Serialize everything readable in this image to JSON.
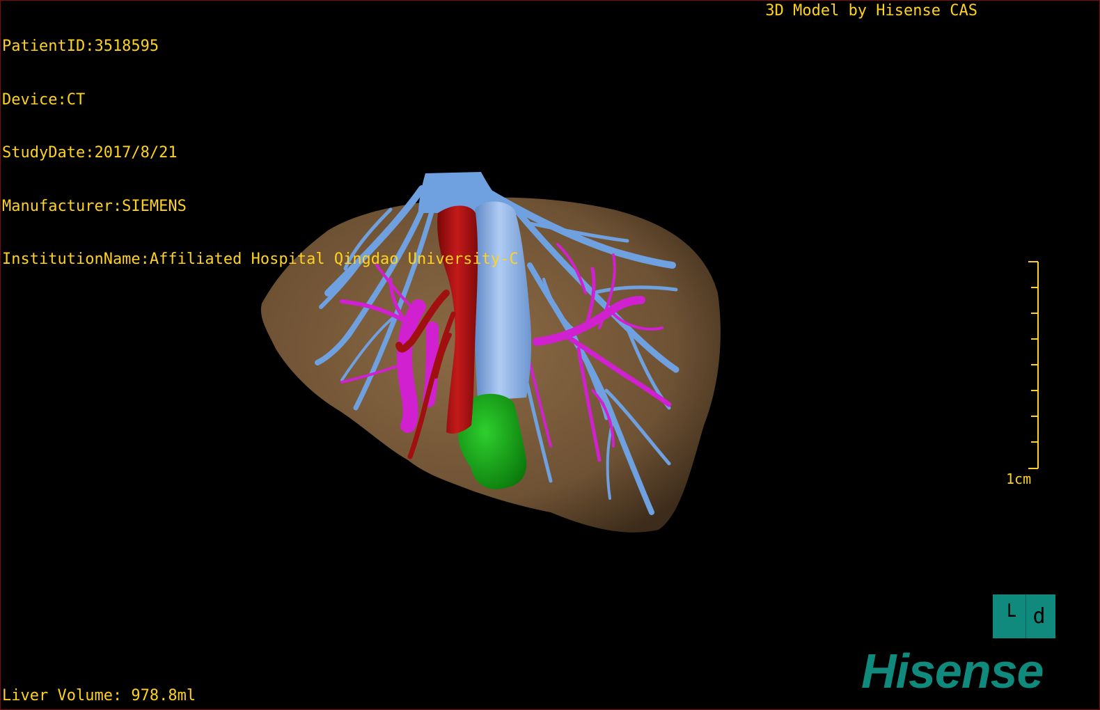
{
  "study": {
    "patient_id": "PatientID:3518595",
    "device": "Device:CT",
    "study_date": "StudyDate:2017/8/21",
    "manufacturer": "Manufacturer:SIEMENS",
    "institution": "InstitutionName:Affiliated Hospital Qingdao University-C"
  },
  "credit": "3D Model by Hisense CAS",
  "liver_volume": "Liver Volume: 978.8ml",
  "scale": {
    "label": "1cm"
  },
  "view_cube": {
    "left_face": "└",
    "right_face": "d"
  },
  "brand": {
    "name": "Hisense"
  },
  "colors": {
    "overlay_text": "#ffd21f",
    "liver": "#7a5a38",
    "hepatic_vein": "#6fa0e0",
    "portal_vein": "#d020d0",
    "artery": "#b01010",
    "ivc": "#8fb8f0",
    "gallbladder": "#12a012",
    "brand": "#0f8a7d"
  }
}
